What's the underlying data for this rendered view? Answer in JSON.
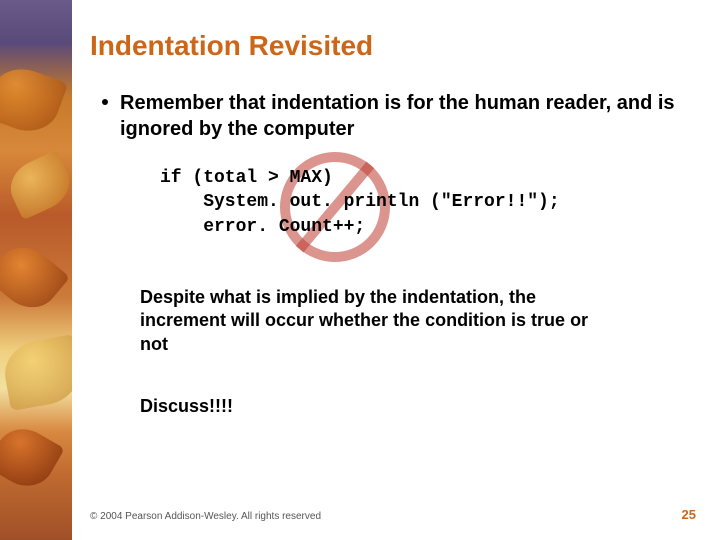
{
  "title": "Indentation Revisited",
  "bullet": "Remember that indentation is for the human reader, and is ignored by the computer",
  "code": "if (total > MAX)\n    System. out. println (\"Error!!\");\n    error. Count++;",
  "followup": "Despite what is implied by the indentation, the increment will occur whether the condition is true or not",
  "discuss": "Discuss!!!!",
  "footer": "© 2004 Pearson Addison-Wesley. All rights reserved",
  "page_number": "25"
}
